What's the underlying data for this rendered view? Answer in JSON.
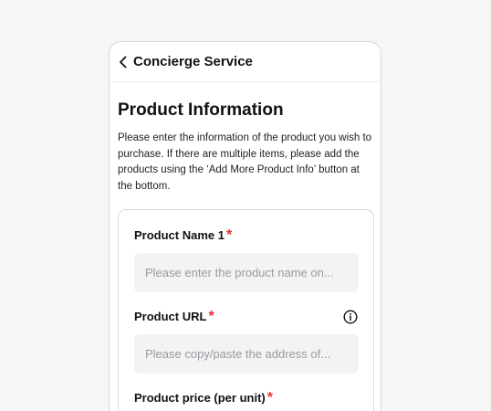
{
  "header": {
    "title": "Concierge Service"
  },
  "page": {
    "title": "Product Information",
    "description": "Please enter the information of the product you wish to purchase. If there are multiple items, please add the products using the ‘Add More Product Info’ button at the bottom."
  },
  "form": {
    "required_mark": "*",
    "fields": [
      {
        "label": "Product Name 1",
        "placeholder": "Please enter the product name on...",
        "value": ""
      },
      {
        "label": "Product URL",
        "placeholder": "Please copy/paste the address of...",
        "value": ""
      },
      {
        "label": "Product price (per unit)",
        "placeholder": "",
        "value": ""
      }
    ]
  },
  "colors": {
    "required": "#e5352b",
    "input_bg": "#f3f3f4",
    "background": "#f6f6f7"
  },
  "icons": {
    "back": "chevron-left-icon",
    "info": "info-circle-icon"
  }
}
